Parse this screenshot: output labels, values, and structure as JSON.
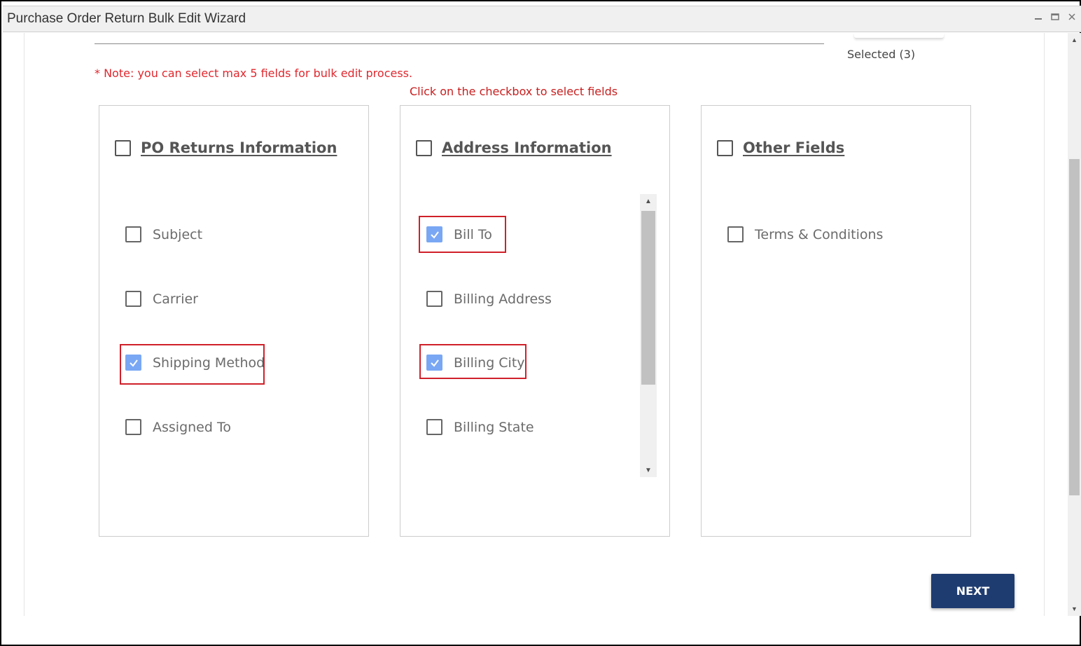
{
  "window": {
    "title": "Purchase Order Return Bulk Edit Wizard",
    "controls": [
      "minimize",
      "maximize",
      "close"
    ]
  },
  "header": {
    "selected_label": "Selected (3)"
  },
  "note": "* Note: you can select max 5 fields for bulk edit process.",
  "hint": "Click on the checkbox to select fields",
  "panels": [
    {
      "title": "PO Returns Information",
      "checked": false,
      "fields": [
        {
          "label": "Subject",
          "checked": false
        },
        {
          "label": "Carrier",
          "checked": false
        },
        {
          "label": "Shipping Method",
          "checked": true
        },
        {
          "label": "Assigned To",
          "checked": false
        }
      ]
    },
    {
      "title": "Address Information",
      "checked": false,
      "fields": [
        {
          "label": "Bill To",
          "checked": true
        },
        {
          "label": "Billing Address",
          "checked": false
        },
        {
          "label": "Billing City",
          "checked": true
        },
        {
          "label": "Billing State",
          "checked": false
        }
      ]
    },
    {
      "title": "Other Fields",
      "checked": false,
      "fields": [
        {
          "label": "Terms & Conditions",
          "checked": false
        }
      ]
    }
  ],
  "buttons": {
    "next": "NEXT"
  },
  "colors": {
    "accent": "#1f3c70",
    "checked": "#7aa7f4",
    "highlight": "#d0202a",
    "note": "#e0282e"
  }
}
